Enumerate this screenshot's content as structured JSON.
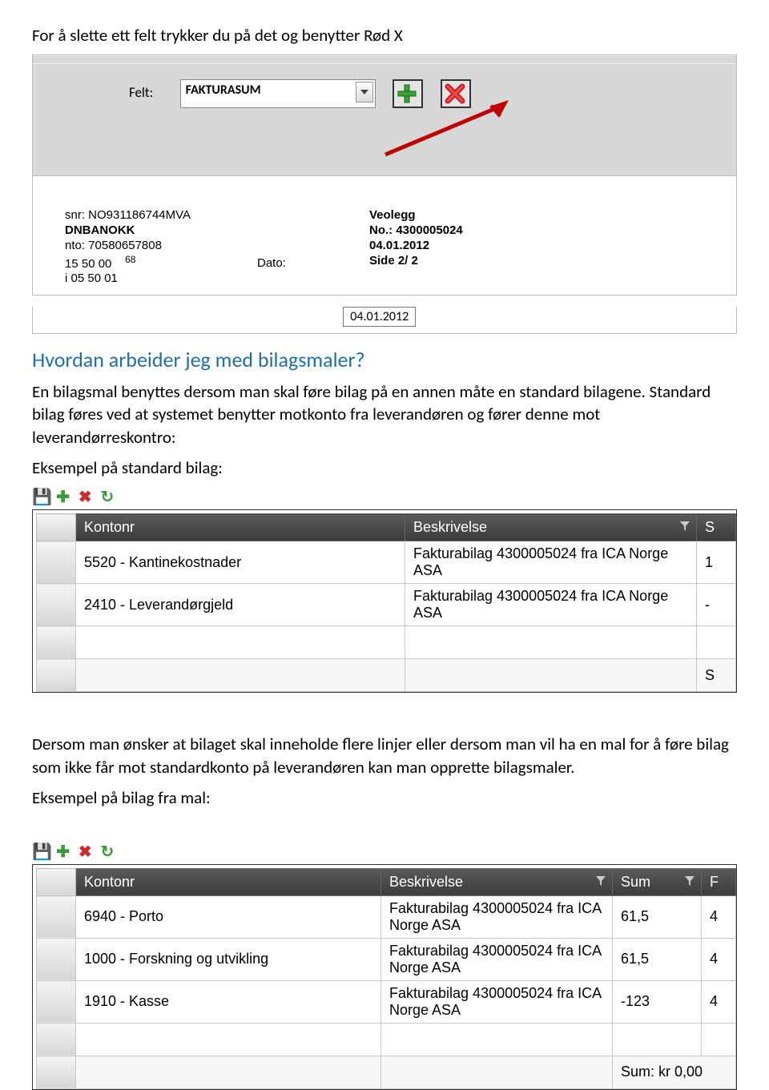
{
  "intro": "For å slette ett felt trykker du på det og benytter Rød X",
  "shot1": {
    "felt_label": "Felt:",
    "felt_value": "FAKTURASUM",
    "left": {
      "snr": "snr: NO931186744MVA",
      "bank": "DNBANOKK",
      "nto": "nto: 70580657808",
      "r1": "15 50 00",
      "r68": "68",
      "r2": "i 05 50 01"
    },
    "mid": {
      "dato_label": "Dato:"
    },
    "right": {
      "veolegg": "Veolegg",
      "no_label": "No.:",
      "no_val": "4300005024",
      "date1": "04.01.2012",
      "side": "Side 2/  2"
    },
    "dato_val": "04.01.2012"
  },
  "h2": "Hvordan arbeider jeg med bilagsmaler?",
  "p1": "En bilagsmal benyttes dersom man skal føre bilag på en annen måte en standard bilagene. Standard bilag føres ved at systemet benytter motkonto fra leverandøren og fører denne mot leverandørreskontro:",
  "p2": "Eksempel på standard bilag:",
  "grid1": {
    "cols": {
      "kontonr": "Kontonr",
      "besk": "Beskrivelse",
      "s": "S"
    },
    "rows": [
      {
        "k": "5520 - Kantinekostnader",
        "b": "Fakturabilag 4300005024 fra ICA Norge ASA",
        "s": "1"
      },
      {
        "k": "2410 - Leverandørgjeld",
        "b": "Fakturabilag 4300005024 fra ICA Norge ASA",
        "s": "-"
      }
    ],
    "footer_s": "S"
  },
  "p3": "Dersom man ønsker at bilaget skal inneholde flere linjer eller dersom man vil ha en mal for å føre bilag som ikke får mot standardkonto på leverandøren kan man opprette bilagsmaler.",
  "p4": "Eksempel på bilag fra mal:",
  "grid2": {
    "cols": {
      "kontonr": "Kontonr",
      "besk": "Beskrivelse",
      "sum": "Sum",
      "f": "F"
    },
    "rows": [
      {
        "k": "6940 - Porto",
        "b": "Fakturabilag 4300005024 fra ICA Norge ASA",
        "s": "61,5",
        "f": "4"
      },
      {
        "k": "1000 - Forskning og utvikling",
        "b": "Fakturabilag 4300005024 fra ICA Norge ASA",
        "s": "61,5",
        "f": "4"
      },
      {
        "k": "1910 - Kasse",
        "b": "Fakturabilag 4300005024 fra ICA Norge ASA",
        "s": "-123",
        "f": "4"
      }
    ],
    "footer_sum": "Sum: kr 0,00"
  }
}
